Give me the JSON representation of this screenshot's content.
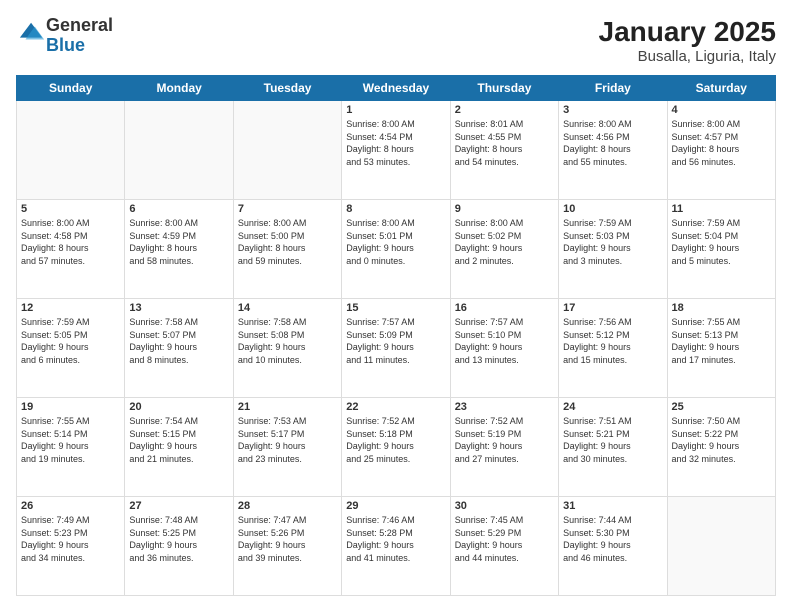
{
  "logo": {
    "general": "General",
    "blue": "Blue"
  },
  "title": "January 2025",
  "subtitle": "Busalla, Liguria, Italy",
  "weekdays": [
    "Sunday",
    "Monday",
    "Tuesday",
    "Wednesday",
    "Thursday",
    "Friday",
    "Saturday"
  ],
  "weeks": [
    [
      {
        "day": "",
        "info": ""
      },
      {
        "day": "",
        "info": ""
      },
      {
        "day": "",
        "info": ""
      },
      {
        "day": "1",
        "info": "Sunrise: 8:00 AM\nSunset: 4:54 PM\nDaylight: 8 hours\nand 53 minutes."
      },
      {
        "day": "2",
        "info": "Sunrise: 8:01 AM\nSunset: 4:55 PM\nDaylight: 8 hours\nand 54 minutes."
      },
      {
        "day": "3",
        "info": "Sunrise: 8:00 AM\nSunset: 4:56 PM\nDaylight: 8 hours\nand 55 minutes."
      },
      {
        "day": "4",
        "info": "Sunrise: 8:00 AM\nSunset: 4:57 PM\nDaylight: 8 hours\nand 56 minutes."
      }
    ],
    [
      {
        "day": "5",
        "info": "Sunrise: 8:00 AM\nSunset: 4:58 PM\nDaylight: 8 hours\nand 57 minutes."
      },
      {
        "day": "6",
        "info": "Sunrise: 8:00 AM\nSunset: 4:59 PM\nDaylight: 8 hours\nand 58 minutes."
      },
      {
        "day": "7",
        "info": "Sunrise: 8:00 AM\nSunset: 5:00 PM\nDaylight: 8 hours\nand 59 minutes."
      },
      {
        "day": "8",
        "info": "Sunrise: 8:00 AM\nSunset: 5:01 PM\nDaylight: 9 hours\nand 0 minutes."
      },
      {
        "day": "9",
        "info": "Sunrise: 8:00 AM\nSunset: 5:02 PM\nDaylight: 9 hours\nand 2 minutes."
      },
      {
        "day": "10",
        "info": "Sunrise: 7:59 AM\nSunset: 5:03 PM\nDaylight: 9 hours\nand 3 minutes."
      },
      {
        "day": "11",
        "info": "Sunrise: 7:59 AM\nSunset: 5:04 PM\nDaylight: 9 hours\nand 5 minutes."
      }
    ],
    [
      {
        "day": "12",
        "info": "Sunrise: 7:59 AM\nSunset: 5:05 PM\nDaylight: 9 hours\nand 6 minutes."
      },
      {
        "day": "13",
        "info": "Sunrise: 7:58 AM\nSunset: 5:07 PM\nDaylight: 9 hours\nand 8 minutes."
      },
      {
        "day": "14",
        "info": "Sunrise: 7:58 AM\nSunset: 5:08 PM\nDaylight: 9 hours\nand 10 minutes."
      },
      {
        "day": "15",
        "info": "Sunrise: 7:57 AM\nSunset: 5:09 PM\nDaylight: 9 hours\nand 11 minutes."
      },
      {
        "day": "16",
        "info": "Sunrise: 7:57 AM\nSunset: 5:10 PM\nDaylight: 9 hours\nand 13 minutes."
      },
      {
        "day": "17",
        "info": "Sunrise: 7:56 AM\nSunset: 5:12 PM\nDaylight: 9 hours\nand 15 minutes."
      },
      {
        "day": "18",
        "info": "Sunrise: 7:55 AM\nSunset: 5:13 PM\nDaylight: 9 hours\nand 17 minutes."
      }
    ],
    [
      {
        "day": "19",
        "info": "Sunrise: 7:55 AM\nSunset: 5:14 PM\nDaylight: 9 hours\nand 19 minutes."
      },
      {
        "day": "20",
        "info": "Sunrise: 7:54 AM\nSunset: 5:15 PM\nDaylight: 9 hours\nand 21 minutes."
      },
      {
        "day": "21",
        "info": "Sunrise: 7:53 AM\nSunset: 5:17 PM\nDaylight: 9 hours\nand 23 minutes."
      },
      {
        "day": "22",
        "info": "Sunrise: 7:52 AM\nSunset: 5:18 PM\nDaylight: 9 hours\nand 25 minutes."
      },
      {
        "day": "23",
        "info": "Sunrise: 7:52 AM\nSunset: 5:19 PM\nDaylight: 9 hours\nand 27 minutes."
      },
      {
        "day": "24",
        "info": "Sunrise: 7:51 AM\nSunset: 5:21 PM\nDaylight: 9 hours\nand 30 minutes."
      },
      {
        "day": "25",
        "info": "Sunrise: 7:50 AM\nSunset: 5:22 PM\nDaylight: 9 hours\nand 32 minutes."
      }
    ],
    [
      {
        "day": "26",
        "info": "Sunrise: 7:49 AM\nSunset: 5:23 PM\nDaylight: 9 hours\nand 34 minutes."
      },
      {
        "day": "27",
        "info": "Sunrise: 7:48 AM\nSunset: 5:25 PM\nDaylight: 9 hours\nand 36 minutes."
      },
      {
        "day": "28",
        "info": "Sunrise: 7:47 AM\nSunset: 5:26 PM\nDaylight: 9 hours\nand 39 minutes."
      },
      {
        "day": "29",
        "info": "Sunrise: 7:46 AM\nSunset: 5:28 PM\nDaylight: 9 hours\nand 41 minutes."
      },
      {
        "day": "30",
        "info": "Sunrise: 7:45 AM\nSunset: 5:29 PM\nDaylight: 9 hours\nand 44 minutes."
      },
      {
        "day": "31",
        "info": "Sunrise: 7:44 AM\nSunset: 5:30 PM\nDaylight: 9 hours\nand 46 minutes."
      },
      {
        "day": "",
        "info": ""
      }
    ]
  ]
}
